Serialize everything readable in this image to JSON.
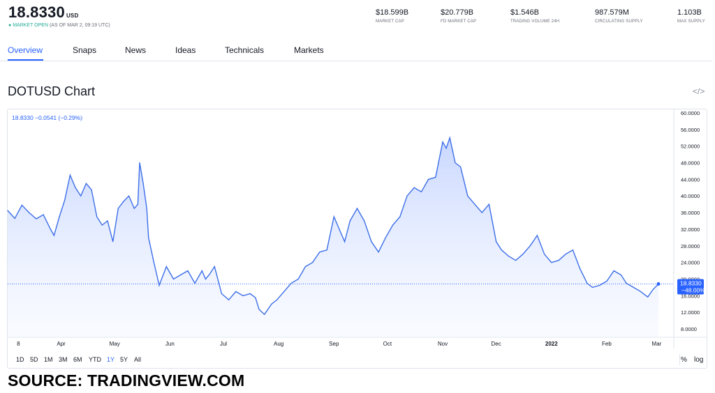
{
  "header": {
    "price": "18.8330",
    "currency": "USD",
    "market_status": "MARKET OPEN",
    "as_of": "(AS OF MAR 2, 09:19 UTC)"
  },
  "stats": [
    {
      "value": "$18.599B",
      "label": "MARKET CAP"
    },
    {
      "value": "$20.779B",
      "label": "FD MARKET CAP"
    },
    {
      "value": "$1.546B",
      "label": "TRADING VOLUME 24H"
    },
    {
      "value": "987.579M",
      "label": "CIRCULATING SUPPLY"
    },
    {
      "value": "1.103B",
      "label": "MAX SUPPLY"
    }
  ],
  "tabs": [
    "Overview",
    "Snaps",
    "News",
    "Ideas",
    "Technicals",
    "Markets"
  ],
  "active_tab": "Overview",
  "chart_title": "DOTUSD Chart",
  "embed_icon": "code-embed-icon",
  "ranges": [
    "1D",
    "5D",
    "1M",
    "3M",
    "6M",
    "YTD",
    "1Y",
    "5Y",
    "All"
  ],
  "active_range": "1Y",
  "scale_buttons": [
    "%",
    "log"
  ],
  "source_text": "SOURCE: TRADINGVIEW.COM",
  "colors": {
    "accent": "#2962ff",
    "line": "#3c6ee8",
    "fill": "#cad8ff",
    "open": "#22ab94"
  },
  "chart_data": {
    "type": "area",
    "legend_text": "18.8330 −0.0541 (−0.29%)",
    "last_price_label": "18.8330",
    "last_change_label": "−48.00%",
    "ylim": [
      6,
      61
    ],
    "y_ticks": [
      "60.0000",
      "56.0000",
      "52.0000",
      "48.0000",
      "44.0000",
      "40.0000",
      "36.0000",
      "32.0000",
      "28.0000",
      "24.0000",
      "20.0000",
      "16.0000",
      "12.0000",
      "8.0000"
    ],
    "x_labels": [
      "8",
      "Apr",
      "May",
      "Jun",
      "Jul",
      "Aug",
      "Sep",
      "Oct",
      "Nov",
      "Dec",
      "2022",
      "Feb",
      "Mar"
    ],
    "x_range": [
      "2021-03-02",
      "2022-03-02"
    ],
    "x_tick_dates": [
      "2021-03-08",
      "2021-04-01",
      "2021-05-01",
      "2021-06-01",
      "2021-07-01",
      "2021-08-01",
      "2021-09-01",
      "2021-10-01",
      "2021-11-01",
      "2021-12-01",
      "2022-01-01",
      "2022-02-01",
      "2022-03-01"
    ],
    "series": [
      {
        "x": [
          "2021-03-02",
          "2021-03-06",
          "2021-03-10",
          "2021-03-14",
          "2021-03-18",
          "2021-03-22",
          "2021-03-26",
          "2021-03-28",
          "2021-03-31",
          "2021-04-03",
          "2021-04-06",
          "2021-04-09",
          "2021-04-12",
          "2021-04-15",
          "2021-04-18",
          "2021-04-21",
          "2021-04-24",
          "2021-04-27",
          "2021-04-30",
          "2021-05-03",
          "2021-05-06",
          "2021-05-09",
          "2021-05-12",
          "2021-05-14",
          "2021-05-15",
          "2021-05-17",
          "2021-05-19",
          "2021-05-20",
          "2021-05-23",
          "2021-05-26",
          "2021-05-30",
          "2021-06-03",
          "2021-06-07",
          "2021-06-11",
          "2021-06-15",
          "2021-06-19",
          "2021-06-21",
          "2021-06-23",
          "2021-06-26",
          "2021-06-30",
          "2021-07-04",
          "2021-07-08",
          "2021-07-12",
          "2021-07-16",
          "2021-07-19",
          "2021-07-21",
          "2021-07-24",
          "2021-07-28",
          "2021-07-31",
          "2021-08-04",
          "2021-08-08",
          "2021-08-12",
          "2021-08-16",
          "2021-08-20",
          "2021-08-24",
          "2021-08-28",
          "2021-09-01",
          "2021-09-04",
          "2021-09-07",
          "2021-09-10",
          "2021-09-14",
          "2021-09-18",
          "2021-09-22",
          "2021-09-26",
          "2021-09-30",
          "2021-10-04",
          "2021-10-08",
          "2021-10-12",
          "2021-10-16",
          "2021-10-20",
          "2021-10-24",
          "2021-10-28",
          "2021-11-01",
          "2021-11-03",
          "2021-11-05",
          "2021-11-08",
          "2021-11-11",
          "2021-11-15",
          "2021-11-19",
          "2021-11-23",
          "2021-11-27",
          "2021-12-01",
          "2021-12-04",
          "2021-12-08",
          "2021-12-12",
          "2021-12-16",
          "2021-12-20",
          "2021-12-24",
          "2021-12-28",
          "2022-01-01",
          "2022-01-05",
          "2022-01-09",
          "2022-01-13",
          "2022-01-17",
          "2022-01-21",
          "2022-01-24",
          "2022-01-28",
          "2022-02-01",
          "2022-02-05",
          "2022-02-09",
          "2022-02-12",
          "2022-02-16",
          "2022-02-20",
          "2022-02-24",
          "2022-02-27",
          "2022-03-02"
        ],
        "values": [
          36.5,
          34.6,
          37.8,
          36,
          34.5,
          35.5,
          32,
          30.5,
          35,
          39,
          45,
          42,
          40,
          43,
          41.5,
          35,
          33,
          34,
          29,
          37,
          38.7,
          40,
          37,
          38,
          48,
          43,
          37,
          30,
          24,
          18.5,
          23,
          20,
          21,
          22,
          19,
          22,
          20,
          21,
          23,
          16.5,
          15,
          17,
          16,
          16.5,
          15.5,
          12.7,
          11.5,
          14,
          15,
          17,
          19,
          20,
          23,
          24,
          26.5,
          27,
          35,
          32,
          29,
          34,
          37,
          34,
          29,
          26.5,
          30,
          33,
          35,
          40,
          42,
          41,
          44,
          44.5,
          53,
          51.5,
          54,
          48,
          47,
          40,
          38,
          36,
          38,
          29,
          27,
          25.5,
          24.5,
          26,
          28,
          30.5,
          26,
          24,
          24.5,
          26,
          27,
          22.5,
          19,
          18,
          18.5,
          19.5,
          22,
          21,
          19,
          18,
          17,
          15.7,
          17.5,
          18.83
        ]
      }
    ]
  }
}
